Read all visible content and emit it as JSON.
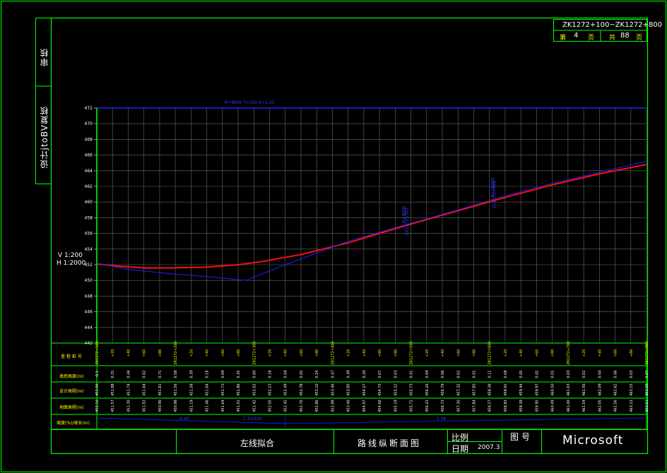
{
  "side_labels": {
    "review": "审核",
    "design": "设计jtoBV复核"
  },
  "header": {
    "stake_range": "ZK1272+100~ZK1272+800",
    "page_prefix": "第",
    "page_no": "4",
    "page_unit": "页",
    "total_prefix": "共",
    "total_no": "88",
    "total_unit": "页"
  },
  "scale_note": {
    "vertical": "V 1:200",
    "horizontal": "H 1:2000"
  },
  "design_line_label": "R=9000 T=150 E=1.25",
  "title_block": {
    "drawing_name": "左线拟合",
    "drawing_title": "路线纵断面图",
    "scale_label": "比例",
    "date_label": "日期",
    "date_value": "2007.3",
    "figure_label": "图号",
    "brand": "Microsoft"
  },
  "table_row_labels": [
    "里 程 桩 号",
    "填挖高度(m)",
    "设计高程(m)",
    "地面高程(m)",
    "坡度(%)/坡长(m)"
  ],
  "slope_labels": [
    "-0.45",
    "1.33/520",
    "1.98"
  ],
  "curve_labels": [
    "R=9000",
    "R=20000",
    "ZK1272+565",
    "ZK1272+660"
  ],
  "colors": {
    "frame": "#00ff00",
    "design_line": "#ff1010",
    "ground_line": "#2020ff",
    "grid": "#6a6a6a",
    "axis": "#00ff00",
    "text": "#ffffff",
    "station_text": "#ffff00"
  },
  "chart_data": {
    "type": "line",
    "xlabel": "里程桩号",
    "ylabel": "",
    "x_range": [
      100,
      800
    ],
    "ylim": [
      442,
      472
    ],
    "y_ticks": [
      442,
      444,
      446,
      448,
      450,
      452,
      454,
      456,
      458,
      460,
      462,
      464,
      466,
      468,
      470,
      472
    ],
    "grid": true,
    "series": [
      {
        "x": [
          100,
          130,
          160,
          200,
          240,
          280,
          310,
          360,
          420,
          460,
          500,
          560,
          620,
          680,
          740,
          800
        ],
        "values": [
          452.1,
          451.8,
          451.6,
          451.6,
          451.7,
          452.0,
          452.4,
          453.3,
          454.8,
          456.0,
          457.2,
          458.9,
          460.6,
          462.2,
          463.6,
          464.8
        ]
      },
      {
        "x": [
          100,
          140,
          200,
          250,
          290,
          340,
          420,
          500,
          560,
          620,
          680,
          740,
          800
        ],
        "values": [
          452.2,
          451.4,
          450.8,
          450.4,
          450.0,
          452.0,
          455.0,
          457.3,
          459.0,
          460.8,
          462.4,
          463.8,
          465.2
        ]
      }
    ]
  },
  "table": {
    "stations": [
      "ZK1272+100",
      "+20",
      "+40",
      "+60",
      "+80",
      "ZK1272+200",
      "+20",
      "+40",
      "+60",
      "+80",
      "ZK1272+300",
      "+20",
      "+40",
      "+60",
      "+80",
      "ZK1272+400",
      "+20",
      "+40",
      "+60",
      "+80",
      "ZK1272+500",
      "+20",
      "+40",
      "+60",
      "+80",
      "ZK1272+600",
      "+20",
      "+40",
      "+60",
      "+80",
      "ZK1272+700",
      "+20",
      "+40",
      "+60",
      "+80",
      "ZK1272+800"
    ],
    "cut_fill": [
      "-0.1",
      "0.31",
      "0.44",
      "0.62",
      "0.71",
      "0.58",
      "0.39",
      "0.18",
      "0.09",
      "0.35",
      "0.60",
      "0.18",
      "0.04",
      "0.02",
      "0.24",
      "0.47",
      "0.39",
      "0.20",
      "0.07",
      "0.03",
      "0.01",
      "0.04",
      "0.06",
      "0.02",
      "0.01",
      "0.11",
      "0.08",
      "0.05",
      "0.02",
      "0.01",
      "0.03",
      "0.02",
      "0.04",
      "0.06",
      "0.03",
      "0.07"
    ],
    "design_elev": [
      "452.06",
      "451.88",
      "451.74",
      "451.64",
      "451.61",
      "451.56",
      "451.58",
      "451.64",
      "451.73",
      "451.86",
      "452.02",
      "452.23",
      "452.49",
      "452.78",
      "453.10",
      "453.46",
      "453.85",
      "454.27",
      "454.73",
      "455.22",
      "455.73",
      "456.26",
      "456.79",
      "457.32",
      "457.85",
      "458.38",
      "458.91",
      "459.44",
      "459.97",
      "460.50",
      "461.03",
      "461.56",
      "462.09",
      "462.62",
      "463.15",
      "463.68"
    ],
    "ground_elev": [
      "452.16",
      "451.57",
      "451.30",
      "451.02",
      "450.90",
      "450.98",
      "451.19",
      "451.46",
      "451.64",
      "451.51",
      "451.42",
      "452.05",
      "452.45",
      "452.76",
      "452.86",
      "452.99",
      "453.46",
      "454.07",
      "454.66",
      "455.19",
      "455.72",
      "456.22",
      "456.73",
      "457.30",
      "457.84",
      "458.27",
      "458.83",
      "459.39",
      "459.95",
      "460.49",
      "461.00",
      "461.54",
      "462.05",
      "462.56",
      "463.12",
      "463.61"
    ]
  }
}
